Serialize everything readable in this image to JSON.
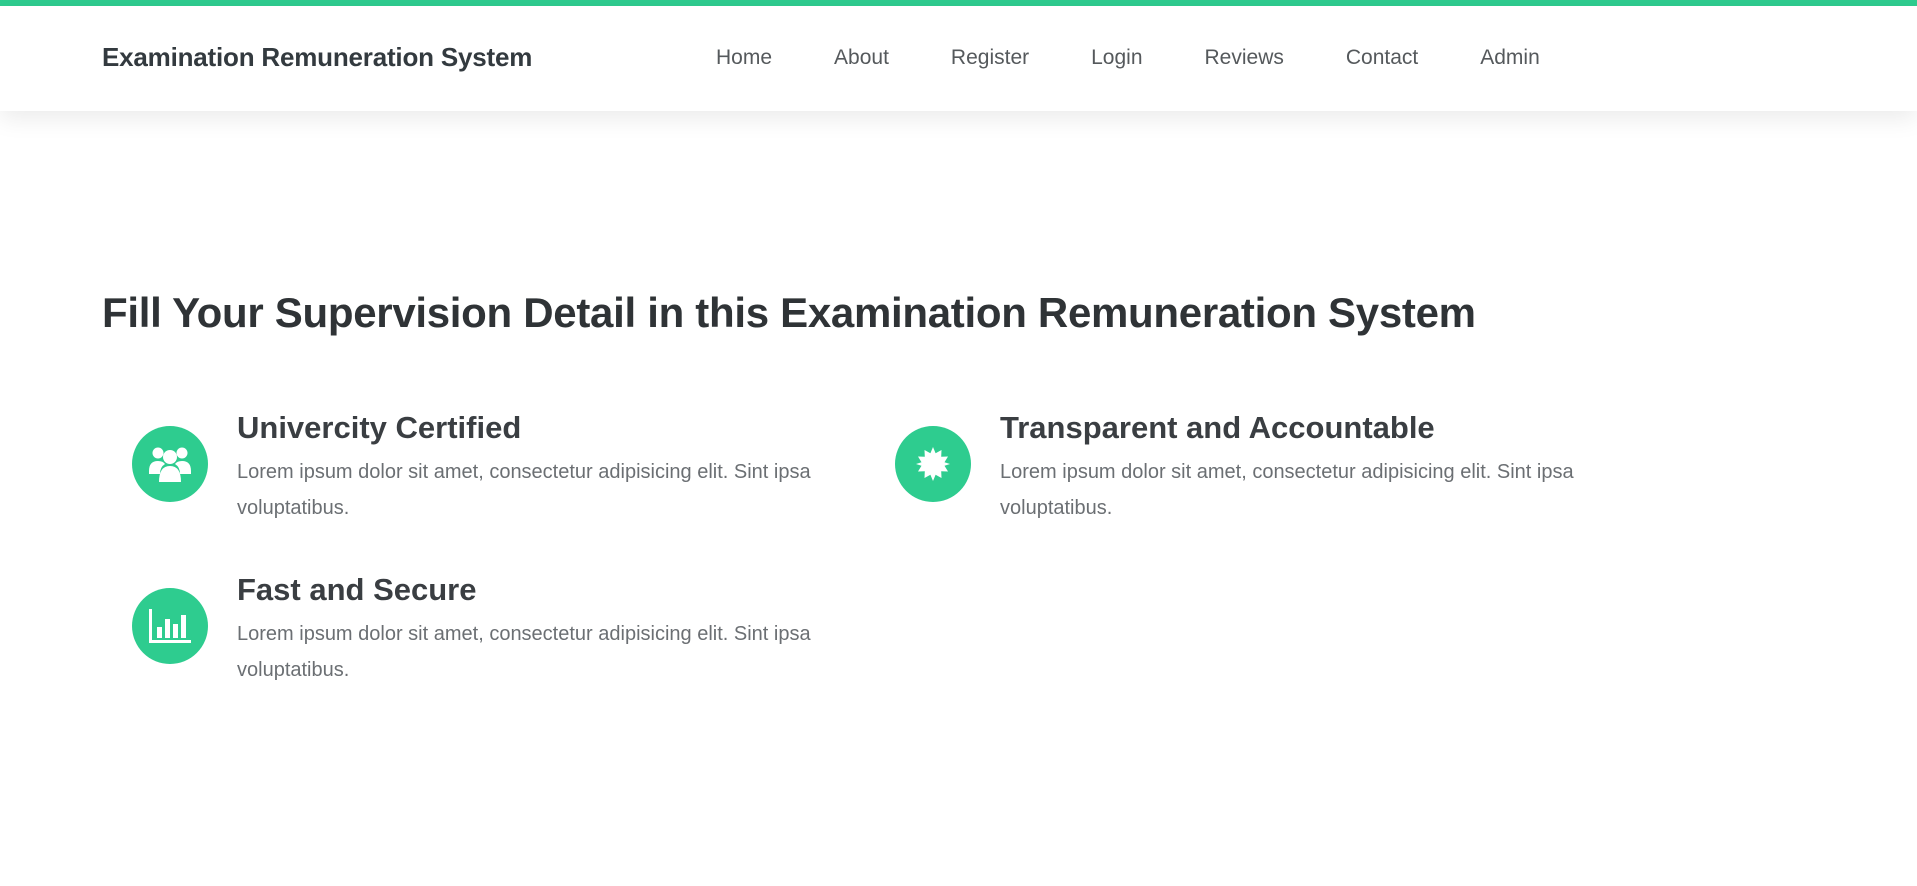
{
  "header": {
    "brand": "Examination Remuneration System",
    "nav": [
      "Home",
      "About",
      "Register",
      "Login",
      "Reviews",
      "Contact",
      "Admin"
    ]
  },
  "main": {
    "headline": "Fill Your Supervision Detail in this Examination Remuneration System",
    "features": [
      {
        "icon": "users-icon",
        "title": "Univercity Certified",
        "text": "Lorem ipsum dolor sit amet, consectetur adipisicing elit. Sint ipsa voluptatibus."
      },
      {
        "icon": "badge-icon",
        "title": "Transparent and Accountable",
        "text": "Lorem ipsum dolor sit amet, consectetur adipisicing elit. Sint ipsa voluptatibus."
      },
      {
        "icon": "bar-chart-icon",
        "title": "Fast and Secure",
        "text": "Lorem ipsum dolor sit amet, consectetur adipisicing elit. Sint ipsa voluptatibus."
      }
    ]
  },
  "colors": {
    "accent": "#2ecc8f",
    "heading": "#2f3336",
    "body_text": "#6b6f73"
  }
}
